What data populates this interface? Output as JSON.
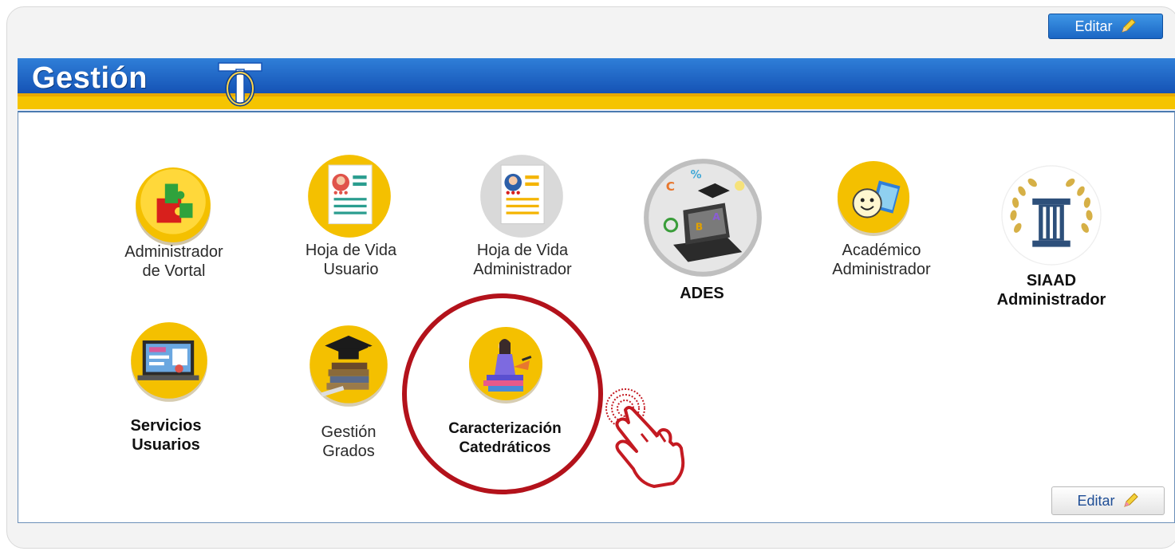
{
  "header": {
    "title": "Gestión",
    "edit_label": "Editar"
  },
  "footer": {
    "edit_label": "Editar"
  },
  "items": [
    {
      "label": "Administrador\nde Vortal",
      "icon": "puzzle-icon"
    },
    {
      "label": "Hoja de Vida\nUsuario",
      "icon": "resume-user-icon"
    },
    {
      "label": "Hoja de Vida\nAdministrador",
      "icon": "resume-admin-icon"
    },
    {
      "label": "ADES",
      "icon": "ades-laptop-icon"
    },
    {
      "label": "Académico\nAdministrador",
      "icon": "smiley-book-icon"
    },
    {
      "label": "SIAAD\nAdministrador",
      "icon": "column-laurel-icon"
    },
    {
      "label": "Servicios\nUsuarios",
      "icon": "laptop-services-icon"
    },
    {
      "label": "Gestión\nGrados",
      "icon": "graduation-cap-icon"
    },
    {
      "label": "Caracterización\nCatedráticos",
      "icon": "teacher-books-icon"
    }
  ],
  "colors": {
    "banner_blue": "#1e6bc9",
    "banner_yellow": "#f5c400",
    "highlight_red": "#b3121b"
  }
}
